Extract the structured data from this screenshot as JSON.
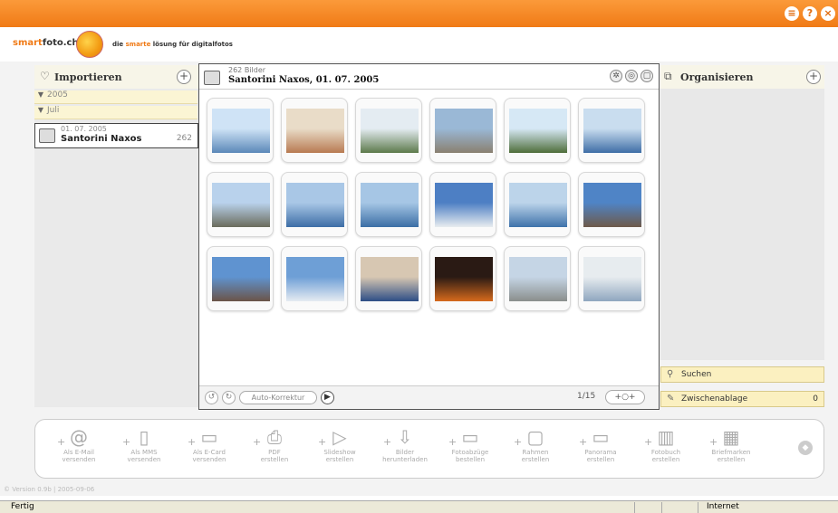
{
  "brand": {
    "name_a": "smart",
    "name_b": "foto.ch",
    "tagline_a": "die ",
    "tagline_b": "smarte",
    "tagline_c": " lösung für digitalfotos"
  },
  "window_buttons": [
    "≡",
    "?",
    "×"
  ],
  "import_panel": {
    "title": "Importieren",
    "tree": [
      {
        "label": "2005"
      },
      {
        "label": "Juli"
      }
    ],
    "album": {
      "date": "01. 07. 2005",
      "name": "Santorini Naxos",
      "count": "262"
    }
  },
  "center": {
    "count_text": "262 Bilder",
    "title": "Santorini Naxos, 01. 07. 2005",
    "auto_label": "Auto-Korrektur",
    "page_text": "1/15"
  },
  "photos": [
    {
      "c1": "#cfe3f6",
      "c2": "#5b88b8"
    },
    {
      "c1": "#e9dcc8",
      "c2": "#b87a52"
    },
    {
      "c1": "#e4ecf2",
      "c2": "#5d7a4b"
    },
    {
      "c1": "#9ab8d6",
      "c2": "#8a8070"
    },
    {
      "c1": "#d6e8f5",
      "c2": "#4f6e3a"
    },
    {
      "c1": "#c9ddef",
      "c2": "#3f6ea6"
    },
    {
      "c1": "#b9d2ec",
      "c2": "#6a6b5c"
    },
    {
      "c1": "#a9c7e6",
      "c2": "#3d6da6"
    },
    {
      "c1": "#a6c6e5",
      "c2": "#3b6ea5"
    },
    {
      "c1": "#4d7fc4",
      "c2": "#e8ecef"
    },
    {
      "c1": "#bcd4ea",
      "c2": "#3e72aa"
    },
    {
      "c1": "#4f84c6",
      "c2": "#6e5a4a"
    },
    {
      "c1": "#5f93d0",
      "c2": "#6b5448"
    },
    {
      "c1": "#6e9fd6",
      "c2": "#e5ebf1"
    },
    {
      "c1": "#d7c7b2",
      "c2": "#2d4e86"
    },
    {
      "c1": "#2a1a14",
      "c2": "#d66a1c"
    },
    {
      "c1": "#c5d5e5",
      "c2": "#8a8e8c"
    },
    {
      "c1": "#e7ecef",
      "c2": "#8fa6bf"
    }
  ],
  "organize_panel": {
    "title": "Organisieren"
  },
  "search": {
    "label": "Suchen"
  },
  "clipboard": {
    "label": "Zwischenablage",
    "count": "0"
  },
  "actions": [
    {
      "l1": "Als E-Mail",
      "l2": "versenden",
      "glyph": "@"
    },
    {
      "l1": "Als MMS",
      "l2": "versenden",
      "glyph": "▯"
    },
    {
      "l1": "Als E-Card",
      "l2": "versenden",
      "glyph": "▭"
    },
    {
      "l1": "PDF",
      "l2": "erstellen",
      "glyph": "⎙"
    },
    {
      "l1": "Slideshow",
      "l2": "erstellen",
      "glyph": "▷"
    },
    {
      "l1": "Bilder",
      "l2": "herunterladen",
      "glyph": "⇩"
    },
    {
      "l1": "Fotoabzüge",
      "l2": "bestellen",
      "glyph": "▭"
    },
    {
      "l1": "Rahmen",
      "l2": "erstellen",
      "glyph": "▢"
    },
    {
      "l1": "Panorama",
      "l2": "erstellen",
      "glyph": "▭"
    },
    {
      "l1": "Fotobuch",
      "l2": "erstellen",
      "glyph": "▥"
    },
    {
      "l1": "Briefmarken",
      "l2": "erstellen",
      "glyph": "▦"
    }
  ],
  "version": "© Version 0.9b | 2005-09-06",
  "status": {
    "text": "Fertig",
    "zone": "Internet"
  },
  "colors": {
    "accent": "#f07a16",
    "panel": "#f0efe8"
  }
}
